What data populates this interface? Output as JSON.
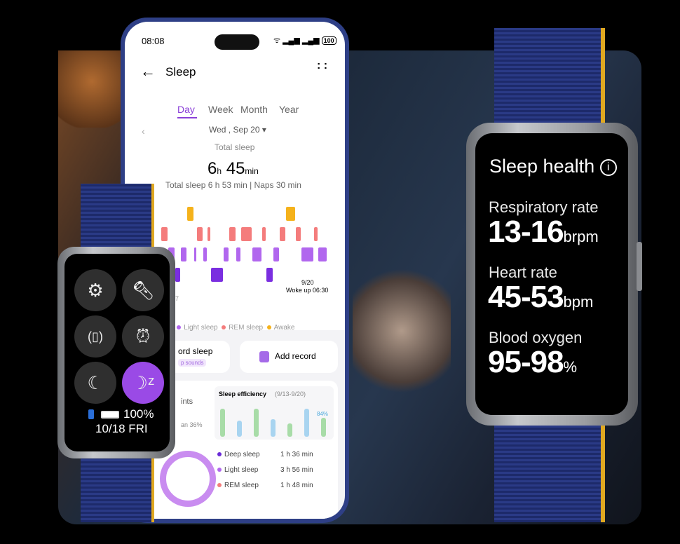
{
  "phone": {
    "status": {
      "time": "08:08",
      "battery": "100"
    },
    "header": {
      "title": "Sleep"
    },
    "tabs": [
      "Day",
      "Week",
      "Month",
      "Year"
    ],
    "active_tab": "Day",
    "date": "Wed , Sep 20",
    "total_label": "Total sleep",
    "total_h": "6",
    "h_unit": "h",
    "total_m": "45",
    "m_unit": "min",
    "summary": "Total sleep 6 h 53 min | Naps 30 min",
    "chart": {
      "end_date": "9/20",
      "woke": "Woke up 06:30",
      "start_label": "7",
      "stage_colors": {
        "awake": "#f5b21b",
        "rem": "#f47c7c",
        "light": "#b167ee",
        "deep": "#7a2ee0"
      },
      "segments": [
        [
          "rem",
          17
        ],
        [
          "light",
          17
        ],
        [
          "deep",
          13
        ],
        [
          "light",
          14
        ],
        [
          "awake",
          17
        ],
        [
          "light",
          7
        ],
        [
          "rem",
          15
        ],
        [
          "light",
          11
        ],
        [
          "rem",
          7
        ],
        [
          "deep",
          30
        ],
        [
          "light",
          14
        ],
        [
          "rem",
          17
        ],
        [
          "light",
          11
        ],
        [
          "rem",
          28
        ],
        [
          "light",
          23
        ],
        [
          "rem",
          10
        ],
        [
          "deep",
          16
        ],
        [
          "light",
          15
        ],
        [
          "rem",
          15
        ],
        [
          "awake",
          23
        ],
        [
          "rem",
          14
        ],
        [
          "light",
          31
        ],
        [
          "rem",
          10
        ],
        [
          "light",
          21
        ]
      ]
    },
    "legend": [
      "eep",
      "Light sleep",
      "REM sleep",
      "Awake"
    ],
    "record_sleep": "ord sleep",
    "record_sub": "p sounds",
    "add_record": "Add record",
    "points": "ints",
    "points_sub": "an 36%",
    "efficiency": {
      "title": "Sleep efficiency",
      "range": "(9/13-9/20)",
      "last_label": "84%",
      "values": [
        95,
        55,
        95,
        60,
        45,
        95,
        65
      ]
    },
    "breakdown": [
      {
        "name": "Deep sleep",
        "value": "1 h 36 min",
        "color": "#6a2bd8"
      },
      {
        "name": "Light sleep",
        "value": "3 h 56 min",
        "color": "#b167ee"
      },
      {
        "name": "REM sleep",
        "value": "1 h 48 min",
        "color": "#f47c7c"
      }
    ]
  },
  "left_watch": {
    "battery": "100%",
    "date": "10/18 FRI",
    "accent": "#9a4ae6",
    "buttons": [
      "settings",
      "flashlight",
      "vibrate",
      "alarm",
      "moon",
      "sleep"
    ]
  },
  "right_watch": {
    "title": "Sleep health",
    "metrics": [
      {
        "label": "Respiratory rate",
        "value": "13-16",
        "unit": "brpm"
      },
      {
        "label": "Heart rate",
        "value": "45-53",
        "unit": "bpm"
      },
      {
        "label": "Blood oxygen",
        "value": "95-98",
        "unit": "%"
      }
    ]
  }
}
